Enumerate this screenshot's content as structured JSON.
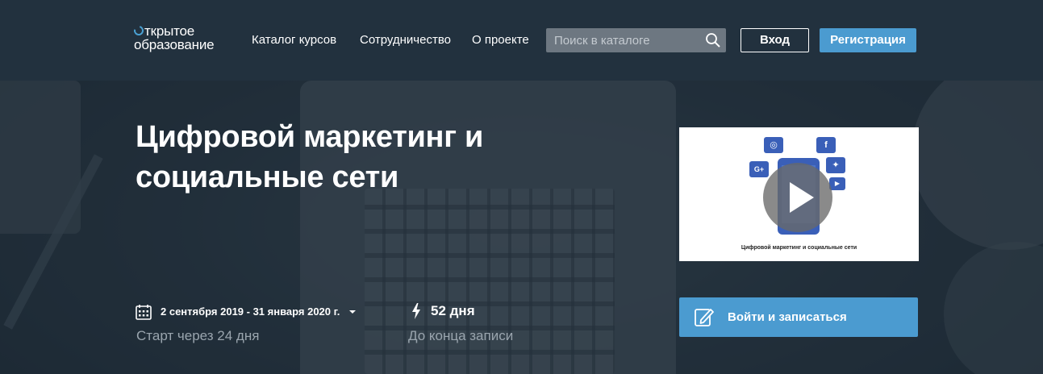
{
  "logo": {
    "line1": "ткрытое",
    "line2": "образование"
  },
  "nav": {
    "items": [
      {
        "label": "Каталог курсов"
      },
      {
        "label": "Сотрудничество"
      },
      {
        "label": "О проекте"
      }
    ]
  },
  "search": {
    "placeholder": "Поиск в каталоге",
    "icon": "search-icon"
  },
  "auth": {
    "login_label": "Вход",
    "register_label": "Регистрация"
  },
  "course": {
    "title_line1": "Цифровой маркетинг и",
    "title_line2": "социальные сети",
    "video_caption": "Цифровой маркетинг и социальные сети",
    "dates": "2 сентября 2019 - 31 января 2020 г.",
    "start_note": "Старт через 24 дня",
    "days_left": "52 дня",
    "days_left_note": "До конца записи",
    "enroll_label": "Войти и записаться"
  },
  "colors": {
    "accent": "#4b9bd0",
    "header_bg": "#22313e",
    "muted_text": "#9aa5ae"
  }
}
